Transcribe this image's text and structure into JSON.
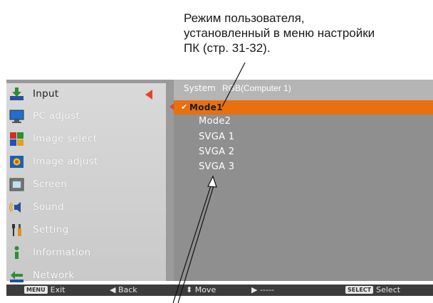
{
  "callout": {
    "line1": "Режим пользователя,",
    "line2": "установленный в меню настройки",
    "line3": "ПК (стр. 31-32)."
  },
  "sidebar": {
    "items": [
      {
        "label": "Input",
        "icon": "input-icon",
        "active": true
      },
      {
        "label": "PC adjust",
        "icon": "pc-adjust-icon"
      },
      {
        "label": "Image select",
        "icon": "image-select-icon"
      },
      {
        "label": "Image adjust",
        "icon": "image-adjust-icon"
      },
      {
        "label": "Screen",
        "icon": "screen-icon"
      },
      {
        "label": "Sound",
        "icon": "sound-icon"
      },
      {
        "label": "Setting",
        "icon": "setting-icon"
      },
      {
        "label": "Information",
        "icon": "information-icon"
      },
      {
        "label": "Network",
        "icon": "network-icon"
      }
    ]
  },
  "system": {
    "label": "System",
    "value": "RGB(Computer 1)"
  },
  "modes": {
    "selected_check": "✔",
    "items": [
      "Mode1",
      "Mode2",
      "SVGA 1",
      "SVGA 2",
      "SVGA 3"
    ]
  },
  "bottombar": {
    "exit_key": "MENU",
    "exit": "Exit",
    "back": "◀ Back",
    "move": "⬍ Move",
    "next": "▶ -----",
    "select_key": "SELECT",
    "select": "Select"
  },
  "colors": {
    "selected_row": "#e8700f",
    "active_arrow": "#e8432a"
  }
}
